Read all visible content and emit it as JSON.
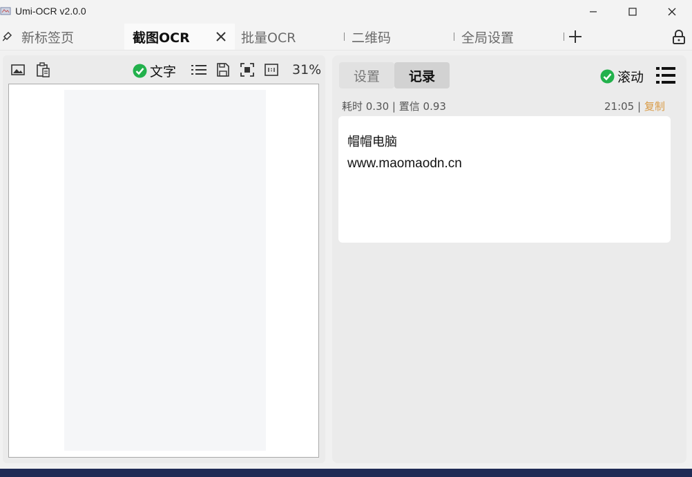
{
  "window": {
    "title": "Umi-OCR v2.0.0"
  },
  "tabs": {
    "new_tab": "新标签页",
    "active": "截图OCR",
    "batch": "批量OCR",
    "qrcode": "二维码",
    "global_settings": "全局设置"
  },
  "left_toolbar": {
    "text_toggle_label": "文字",
    "zoom": "31%"
  },
  "right_panel": {
    "tab_settings": "设置",
    "tab_records": "记录",
    "scroll_toggle_label": "滚动",
    "meta": {
      "time_label": "耗时 0.30 | 置信 0.93",
      "timestamp": "21:05",
      "separator": " | ",
      "copy": "复制"
    },
    "result_lines": [
      "帽帽电脑",
      "www.maomaodn.cn"
    ]
  },
  "colors": {
    "accent_green": "#22b14c",
    "copy_orange": "#d99a44"
  },
  "icons": [
    "app-logo-icon",
    "minimize-icon",
    "maximize-icon",
    "close-icon",
    "pin-icon",
    "tab-close-icon",
    "plus-icon",
    "lock-icon",
    "image-icon",
    "clipboard-icon",
    "check-icon",
    "list-icon",
    "save-icon",
    "fit-screen-icon",
    "original-size-icon",
    "menu-icon"
  ]
}
